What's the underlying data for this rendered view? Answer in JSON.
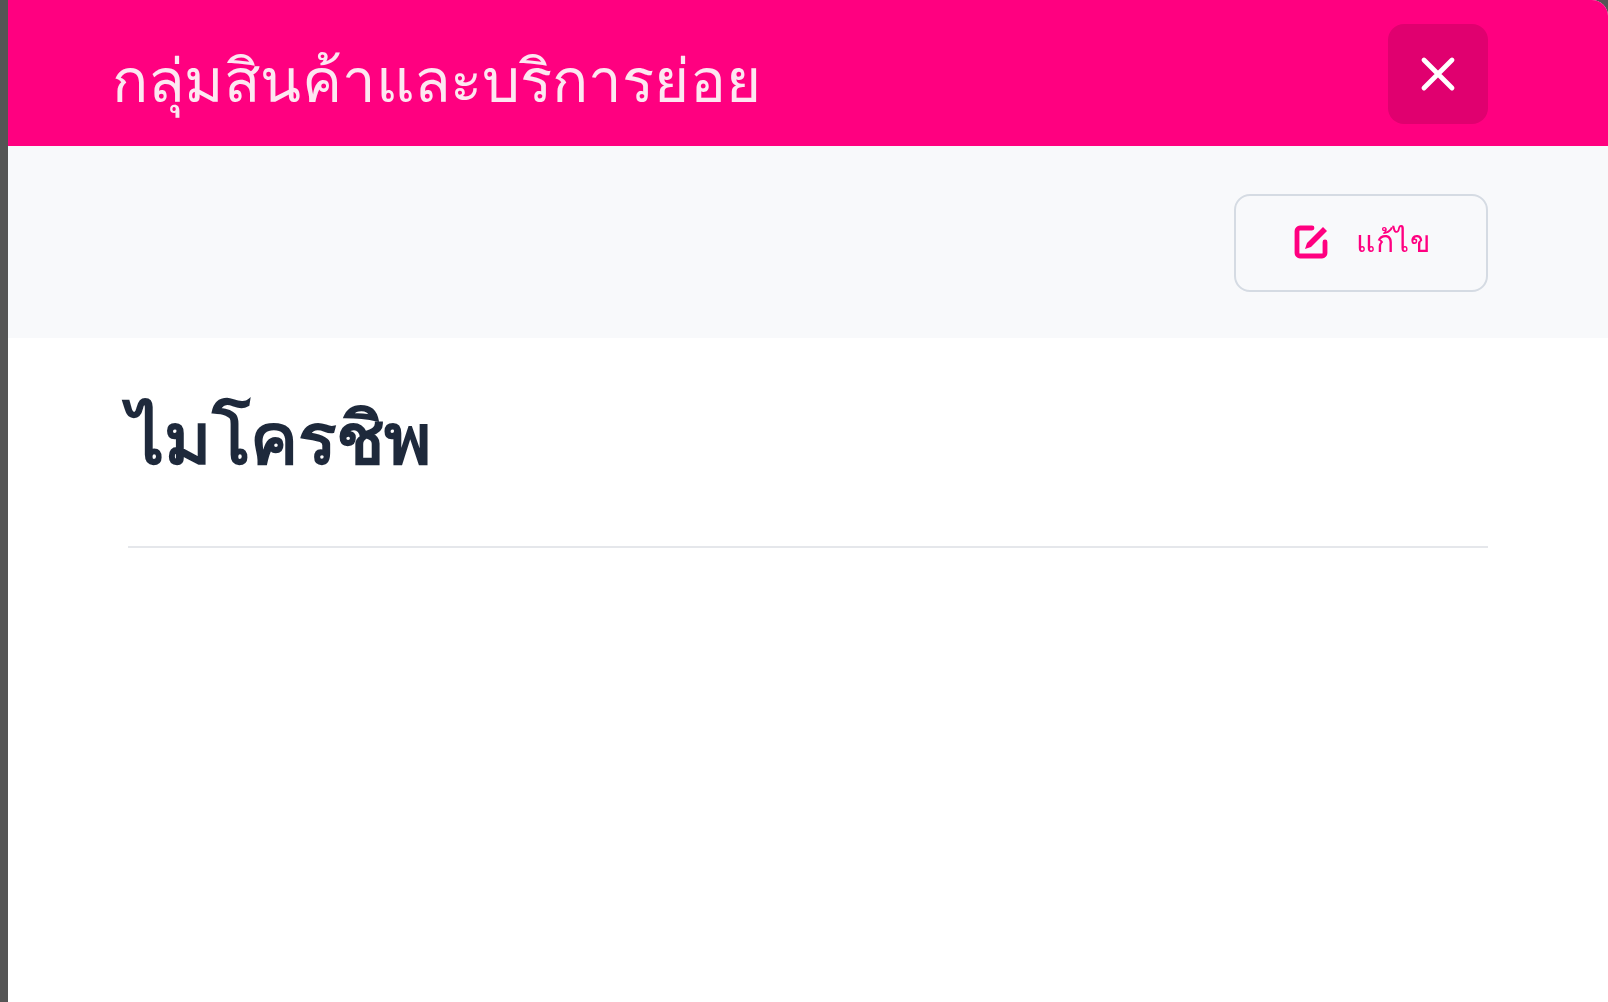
{
  "dialog": {
    "title": "กลุ่มสินค้าและบริการย่อย"
  },
  "toolbar": {
    "edit_button": "แก้ไข"
  },
  "content": {
    "heading": "ไมโครชิพ"
  }
}
